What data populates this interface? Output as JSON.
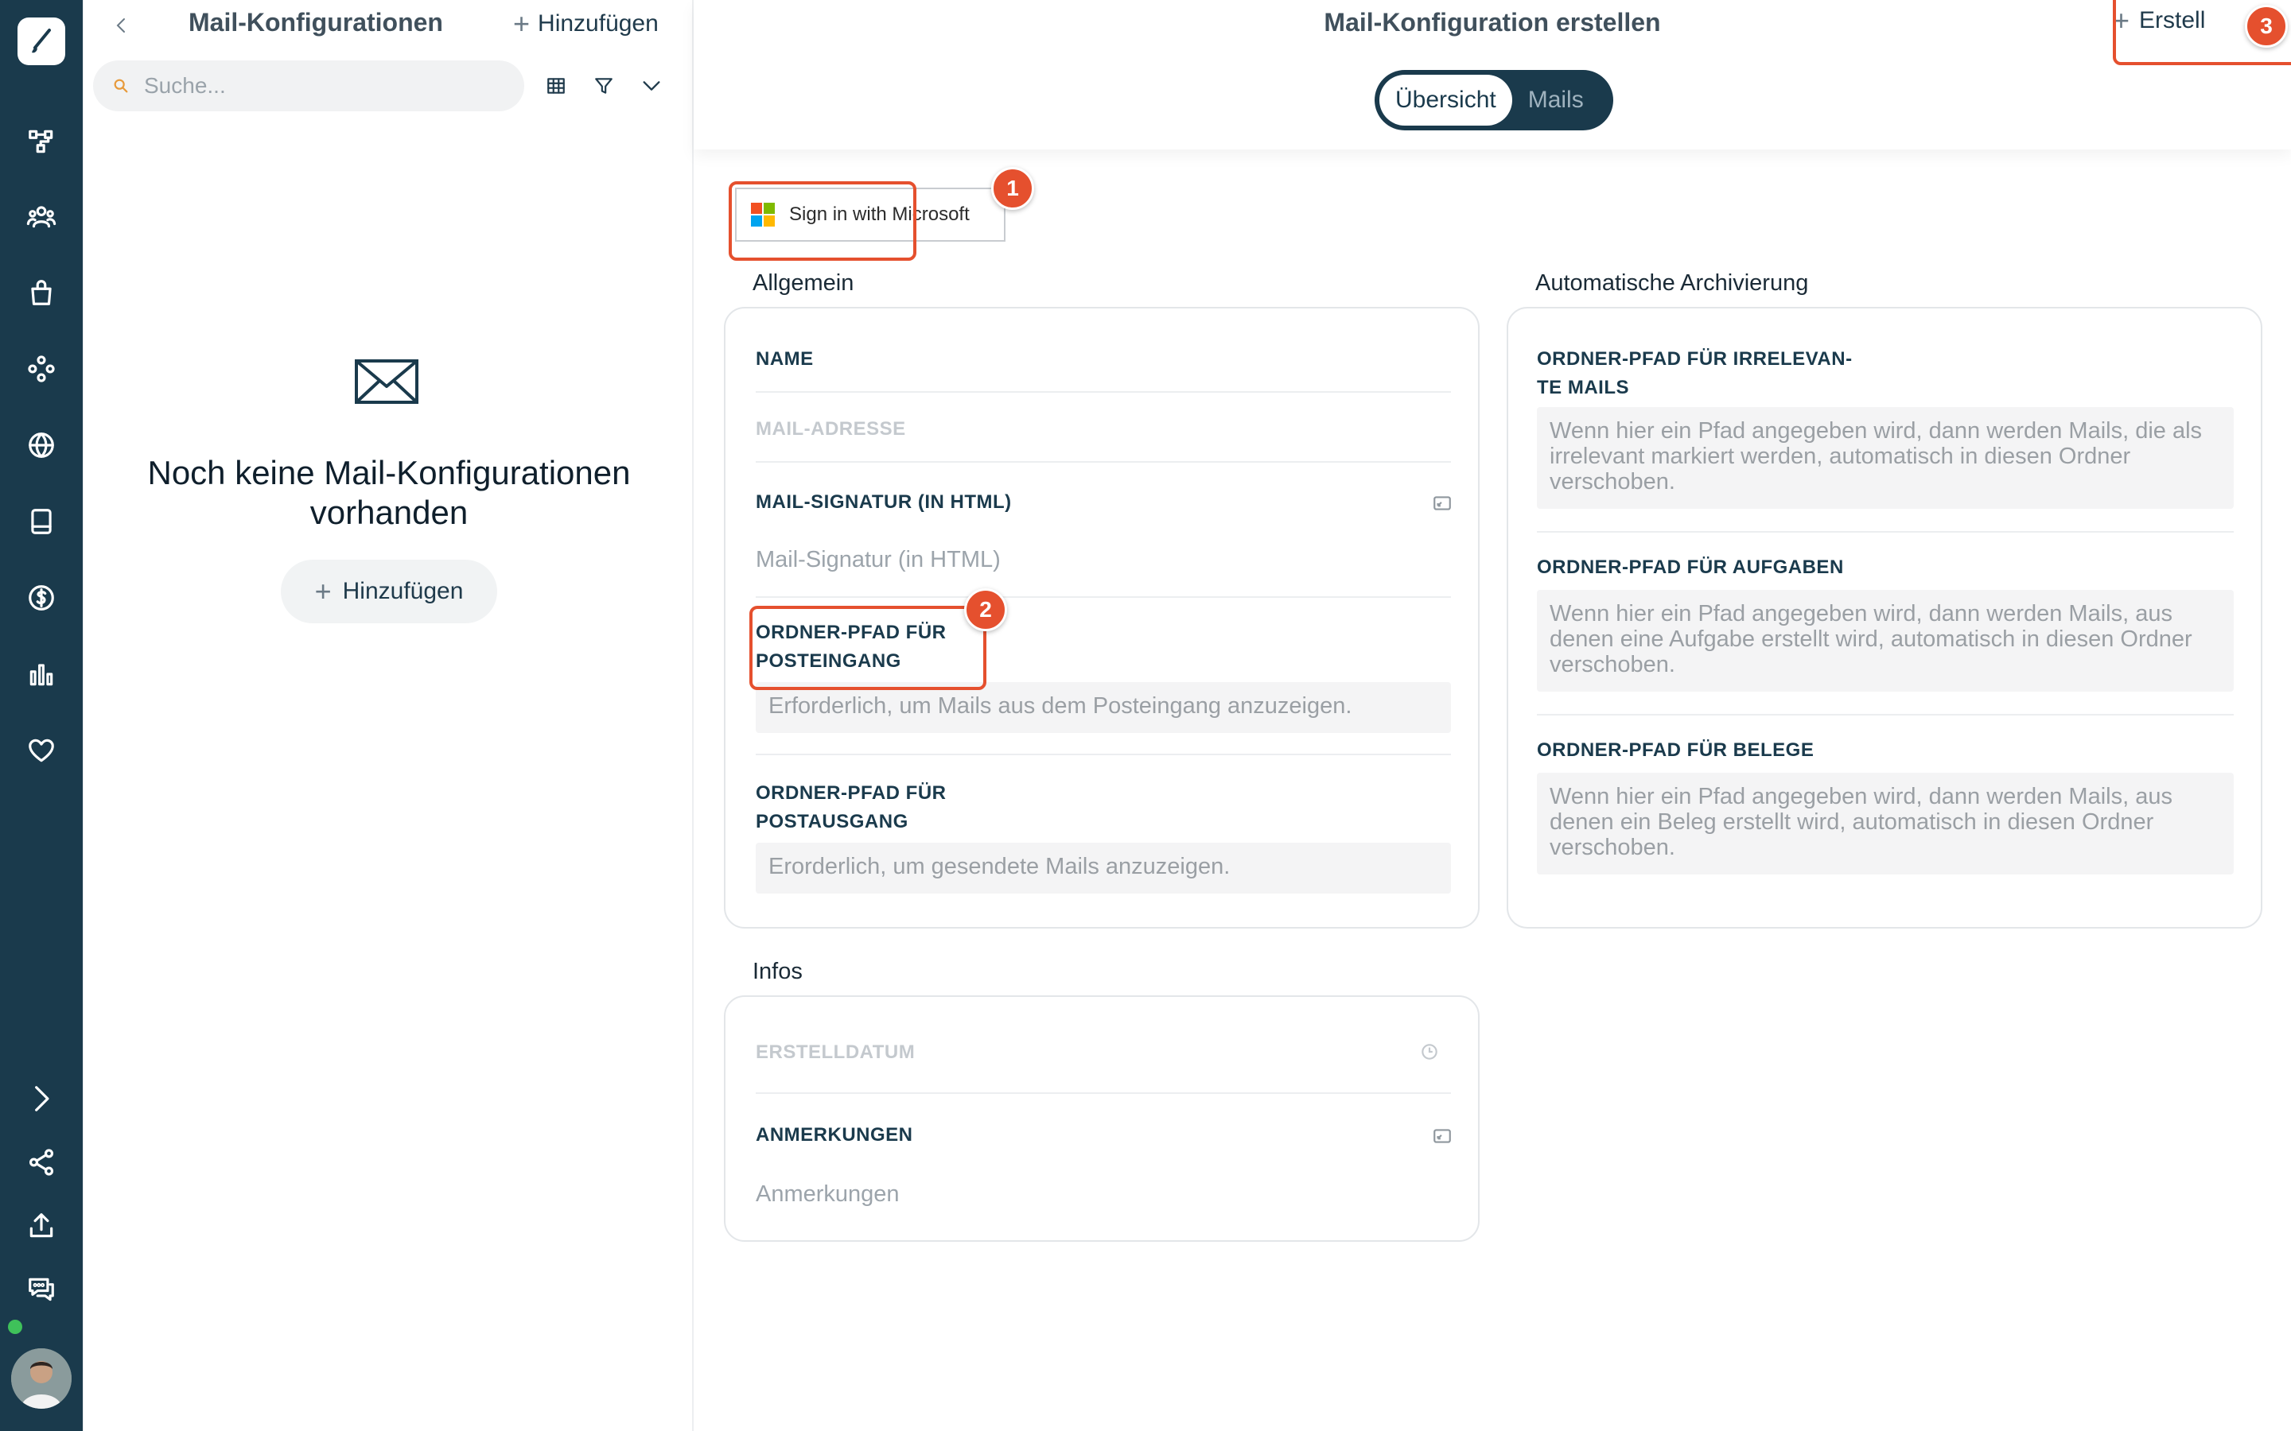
{
  "list": {
    "title": "Mail-Konfigurationen",
    "add_label": "Hinzufügen",
    "search_placeholder": "Suche...",
    "empty_title": "Noch keine Mail-Konfigurationen vorhanden",
    "empty_add_label": "Hinzufügen"
  },
  "main": {
    "title": "Mail-Konfiguration erstellen",
    "tabs": [
      {
        "label": "Übersicht",
        "active": true
      },
      {
        "label": "Mails",
        "active": false
      }
    ],
    "create_label": "Erstell"
  },
  "microsoft": {
    "label": "Sign in with Microsoft"
  },
  "badges": [
    "1",
    "2",
    "3"
  ],
  "general": {
    "title": "Allgemein",
    "name_label": "NAME",
    "mail_address_label": "MAIL-ADRESSE",
    "signature_label": "MAIL-SIGNATUR (IN HTML)",
    "signature_placeholder": "Mail-Signatur (in HTML)",
    "inbox_label_1": "ORDNER-PFAD FÜR",
    "inbox_label_2": "POSTEINGANG",
    "inbox_placeholder": "Erforderlich, um Mails aus dem Posteingang anzuzeigen.",
    "outbox_label_1": "ORDNER-PFAD FÜR",
    "outbox_label_2": "POSTAUSGANG",
    "outbox_placeholder": "Erorderlich, um gesendete Mails anzuzeigen."
  },
  "archive": {
    "title": "Automatische Archivierung",
    "irrelevant_label_1": "ORDNER-PFAD FÜR IRRELEVAN-",
    "irrelevant_label_2": "TE MAILS",
    "irrelevant_placeholder": "Wenn hier ein Pfad angegeben wird, dann werden Mails, die als irrelevant markiert werden, automatisch in diesen Ordner verschoben.",
    "tasks_label": "ORDNER-PFAD FÜR AUFGABEN",
    "tasks_placeholder": "Wenn hier ein Pfad angegeben wird, dann werden Mails, aus denen eine Aufgabe erstellt wird, automatisch in diesen Ordner verschoben.",
    "receipts_label": "ORDNER-PFAD FÜR BELEGE",
    "receipts_placeholder": "Wenn hier ein Pfad angegeben wird, dann werden Mails, aus denen ein Beleg erstellt wird, automatisch in diesen Ordner verschoben."
  },
  "infos": {
    "title": "Infos",
    "created_label": "ERSTELLDATUM",
    "notes_label": "ANMERKUNGEN",
    "notes_placeholder": "Anmerkungen"
  },
  "colors": {
    "sidebar": "#1a3a4c",
    "highlight": "#e5502e",
    "online": "#3fc15a"
  }
}
